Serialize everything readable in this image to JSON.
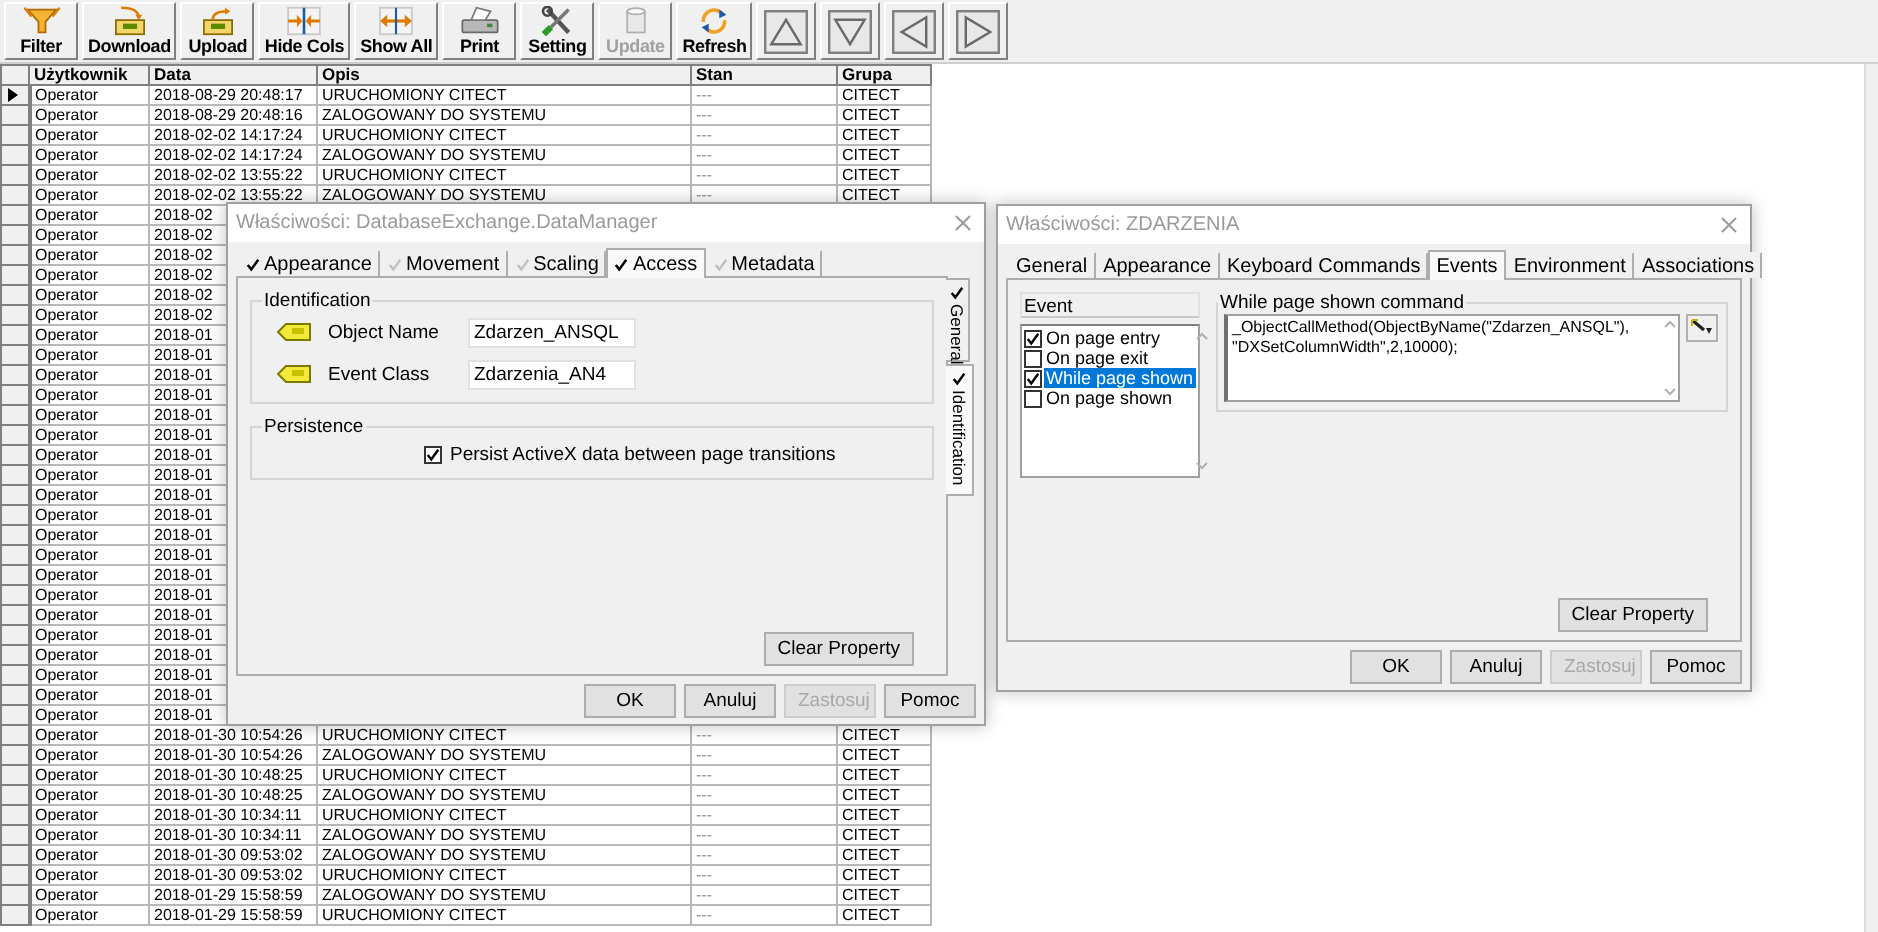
{
  "toolbar": {
    "buttons": [
      {
        "label": "Filter",
        "kind": "filter",
        "disabled": false
      },
      {
        "label": "Download",
        "kind": "download",
        "disabled": false
      },
      {
        "label": "Upload",
        "kind": "upload",
        "disabled": false
      },
      {
        "label": "Hide Cols",
        "kind": "hide",
        "disabled": false
      },
      {
        "label": "Show All",
        "kind": "show",
        "disabled": false
      },
      {
        "label": "Print",
        "kind": "print",
        "disabled": false
      },
      {
        "label": "Setting",
        "kind": "setting",
        "disabled": false
      },
      {
        "label": "Update",
        "kind": "update",
        "disabled": true
      },
      {
        "label": "Refresh",
        "kind": "refresh",
        "disabled": false
      }
    ]
  },
  "table": {
    "columns": [
      "Użytkownik",
      "Data",
      "Opis",
      "Stan",
      "Grupa"
    ],
    "rows": [
      {
        "user": "Operator",
        "date": "2018-08-29 20:48:17",
        "description": "URUCHOMIONY CITECT",
        "status": "---",
        "group": "CITECT",
        "current": true
      },
      {
        "user": "Operator",
        "date": "2018-08-29 20:48:16",
        "description": "ZALOGOWANY DO SYSTEMU",
        "status": "---",
        "group": "CITECT",
        "current": false
      },
      {
        "user": "Operator",
        "date": "2018-02-02 14:17:24",
        "description": "URUCHOMIONY CITECT",
        "status": "---",
        "group": "CITECT",
        "current": false
      },
      {
        "user": "Operator",
        "date": "2018-02-02 14:17:24",
        "description": "ZALOGOWANY DO SYSTEMU",
        "status": "---",
        "group": "CITECT",
        "current": false
      },
      {
        "user": "Operator",
        "date": "2018-02-02 13:55:22",
        "description": "URUCHOMIONY CITECT",
        "status": "---",
        "group": "CITECT",
        "current": false
      },
      {
        "user": "Operator",
        "date": "2018-02-02 13:55:22",
        "description": "ZALOGOWANY DO SYSTEMU",
        "status": "---",
        "group": "CITECT",
        "current": false
      },
      {
        "user": "Operator",
        "date": "2018-02",
        "current": false
      },
      {
        "user": "Operator",
        "date": "2018-02",
        "current": false
      },
      {
        "user": "Operator",
        "date": "2018-02",
        "current": false
      },
      {
        "user": "Operator",
        "date": "2018-02",
        "current": false
      },
      {
        "user": "Operator",
        "date": "2018-02",
        "current": false
      },
      {
        "user": "Operator",
        "date": "2018-02",
        "current": false
      },
      {
        "user": "Operator",
        "date": "2018-01",
        "current": false
      },
      {
        "user": "Operator",
        "date": "2018-01",
        "current": false
      },
      {
        "user": "Operator",
        "date": "2018-01",
        "current": false
      },
      {
        "user": "Operator",
        "date": "2018-01",
        "current": false
      },
      {
        "user": "Operator",
        "date": "2018-01",
        "current": false
      },
      {
        "user": "Operator",
        "date": "2018-01",
        "current": false
      },
      {
        "user": "Operator",
        "date": "2018-01",
        "current": false
      },
      {
        "user": "Operator",
        "date": "2018-01",
        "current": false
      },
      {
        "user": "Operator",
        "date": "2018-01",
        "current": false
      },
      {
        "user": "Operator",
        "date": "2018-01",
        "current": false
      },
      {
        "user": "Operator",
        "date": "2018-01",
        "current": false
      },
      {
        "user": "Operator",
        "date": "2018-01",
        "current": false
      },
      {
        "user": "Operator",
        "date": "2018-01",
        "current": false
      },
      {
        "user": "Operator",
        "date": "2018-01",
        "current": false
      },
      {
        "user": "Operator",
        "date": "2018-01",
        "current": false
      },
      {
        "user": "Operator",
        "date": "2018-01",
        "current": false
      },
      {
        "user": "Operator",
        "date": "2018-01",
        "current": false
      },
      {
        "user": "Operator",
        "date": "2018-01",
        "current": false
      },
      {
        "user": "Operator",
        "date": "2018-01",
        "current": false
      },
      {
        "user": "Operator",
        "date": "2018-01",
        "current": false
      },
      {
        "user": "Operator",
        "date": "2018-01-30 10:54:26",
        "description": "URUCHOMIONY CITECT",
        "status": "---",
        "group": "CITECT",
        "current": false
      },
      {
        "user": "Operator",
        "date": "2018-01-30 10:54:26",
        "description": "ZALOGOWANY DO SYSTEMU",
        "status": "---",
        "group": "CITECT",
        "current": false
      },
      {
        "user": "Operator",
        "date": "2018-01-30 10:48:25",
        "description": "URUCHOMIONY CITECT",
        "status": "---",
        "group": "CITECT",
        "current": false
      },
      {
        "user": "Operator",
        "date": "2018-01-30 10:48:25",
        "description": "ZALOGOWANY DO SYSTEMU",
        "status": "---",
        "group": "CITECT",
        "current": false
      },
      {
        "user": "Operator",
        "date": "2018-01-30 10:34:11",
        "description": "URUCHOMIONY CITECT",
        "status": "---",
        "group": "CITECT",
        "current": false
      },
      {
        "user": "Operator",
        "date": "2018-01-30 10:34:11",
        "description": "ZALOGOWANY DO SYSTEMU",
        "status": "---",
        "group": "CITECT",
        "current": false
      },
      {
        "user": "Operator",
        "date": "2018-01-30 09:53:02",
        "description": "ZALOGOWANY DO SYSTEMU",
        "status": "---",
        "group": "CITECT",
        "current": false
      },
      {
        "user": "Operator",
        "date": "2018-01-30 09:53:02",
        "description": "URUCHOMIONY CITECT",
        "status": "---",
        "group": "CITECT",
        "current": false
      },
      {
        "user": "Operator",
        "date": "2018-01-29 15:58:59",
        "description": "ZALOGOWANY DO SYSTEMU",
        "status": "---",
        "group": "CITECT",
        "current": false
      },
      {
        "user": "Operator",
        "date": "2018-01-29 15:58:59",
        "description": "URUCHOMIONY CITECT",
        "status": "---",
        "group": "CITECT",
        "current": false
      }
    ]
  },
  "properties_dialog": {
    "title": "Właściwości: DatabaseExchange.DataManager",
    "tabs": [
      {
        "label": "Appearance",
        "checked": true,
        "selected": false
      },
      {
        "label": "Movement",
        "checked": false,
        "selected": false
      },
      {
        "label": "Scaling",
        "checked": false,
        "selected": false
      },
      {
        "label": "Access",
        "checked": true,
        "selected": true
      },
      {
        "label": "Metadata",
        "checked": false,
        "selected": false
      }
    ],
    "side_tabs": [
      {
        "label": "General",
        "checked": true,
        "selected": false
      },
      {
        "label": "Identification",
        "checked": true,
        "selected": true
      }
    ],
    "identification": {
      "title": "Identification",
      "fields": [
        {
          "label": "Object Name",
          "value": "Zdarzen_ANSQL"
        },
        {
          "label": "Event Class",
          "value": "Zdarzenia_AN4"
        }
      ]
    },
    "persistence": {
      "title": "Persistence",
      "checkbox": {
        "label": "Persist ActiveX data between page transitions",
        "checked": true
      }
    },
    "clear_button": "Clear Property",
    "buttons": [
      {
        "label": "OK",
        "disabled": false
      },
      {
        "label": "Anuluj",
        "disabled": false
      },
      {
        "label": "Zastosuj",
        "disabled": true
      },
      {
        "label": "Pomoc",
        "disabled": false
      }
    ]
  },
  "events_dialog": {
    "title": "Właściwości: ZDARZENIA",
    "tabs": [
      {
        "label": "General",
        "selected": false
      },
      {
        "label": "Appearance",
        "selected": false
      },
      {
        "label": "Keyboard Commands",
        "selected": false
      },
      {
        "label": "Events",
        "selected": true
      },
      {
        "label": "Environment",
        "selected": false
      },
      {
        "label": "Associations",
        "selected": false
      }
    ],
    "event_list": {
      "header": "Event",
      "items": [
        {
          "label": "On page entry",
          "checked": true,
          "selected": false
        },
        {
          "label": "On page exit",
          "checked": false,
          "selected": false
        },
        {
          "label": "While page shown",
          "checked": true,
          "selected": true
        },
        {
          "label": "On page shown",
          "checked": false,
          "selected": false
        }
      ]
    },
    "command": {
      "title": "While page shown command",
      "value": "_ObjectCallMethod(ObjectByName(\"Zdarzen_ANSQL\"),\n\"DXSetColumnWidth\",2,10000);"
    },
    "clear_button": "Clear Property",
    "buttons": [
      {
        "label": "OK",
        "disabled": false
      },
      {
        "label": "Anuluj",
        "disabled": false
      },
      {
        "label": "Zastosuj",
        "disabled": true
      },
      {
        "label": "Pomoc",
        "disabled": false
      }
    ]
  }
}
